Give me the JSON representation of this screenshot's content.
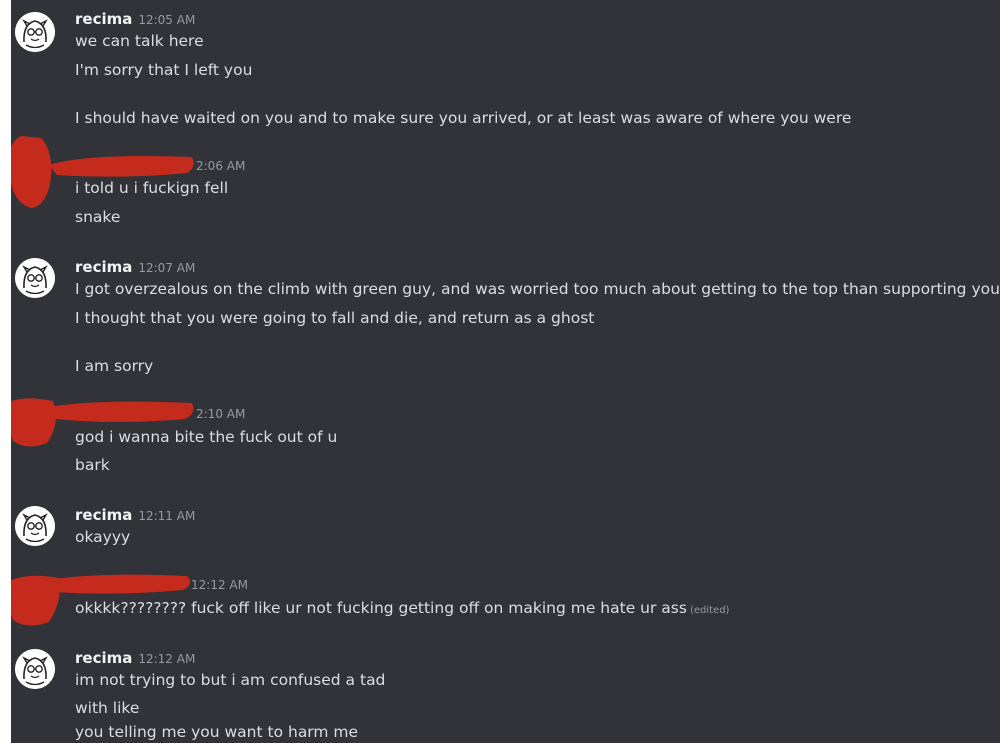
{
  "messages": [
    {
      "author": "recima",
      "time": "12:05 AM",
      "lines": [
        "we can talk here",
        "I'm sorry that I left you",
        "I should have waited on you and to make sure you arrived, or at least was aware of where you were"
      ]
    },
    {
      "author": "",
      "time": "2:06 AM",
      "lines": [
        "i told u i fuckign fell",
        "snake"
      ]
    },
    {
      "author": "recima",
      "time": "12:07 AM",
      "lines": [
        "I got overzealous on the climb with green guy, and was worried too much about getting to the top than supporting you",
        "I thought that you were going to fall and die, and return as a ghost",
        "I am sorry"
      ]
    },
    {
      "author": "",
      "time": "2:10 AM",
      "lines": [
        "god i wanna bite the fuck out of u",
        "bark"
      ]
    },
    {
      "author": "recima",
      "time": "12:11 AM",
      "lines": [
        "okayyy"
      ]
    },
    {
      "author": "",
      "time": "12:12 AM",
      "lines": [
        "okkkk???????? fuck off like ur not fucking getting off on making me hate ur ass"
      ],
      "edited_label": "(edited)"
    },
    {
      "author": "recima",
      "time": "12:12 AM",
      "lines": [
        "im not trying to but i am confused a tad",
        "with like",
        "you telling me you want to harm me"
      ]
    }
  ],
  "colors": {
    "background": "#313338",
    "text": "#dbdee1",
    "username": "#f2f3f5",
    "timestamp": "#949ba4",
    "redaction": "#c42b1c"
  },
  "icons": [
    "user-avatar-icon"
  ]
}
